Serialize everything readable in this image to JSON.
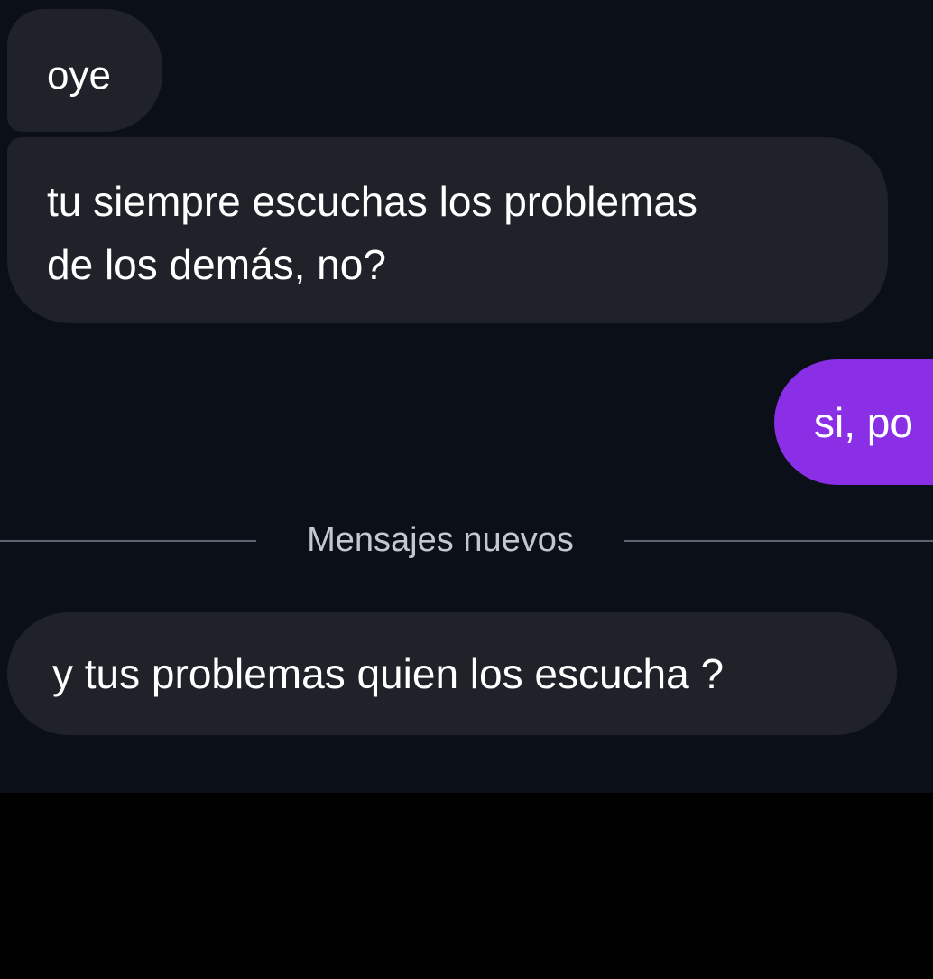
{
  "conversation": {
    "messages": [
      {
        "sender": "other",
        "text": "oye"
      },
      {
        "sender": "other",
        "text": "tu siempre escuchas los problemas\nde los demás, no?"
      },
      {
        "sender": "me",
        "text": "si, po"
      },
      {
        "sender": "other",
        "text": "y tus problemas quien los escucha ?"
      }
    ],
    "new_messages_divider": "Mensajes nuevos"
  },
  "colors": {
    "background": "#0b0f17",
    "incoming_bubble": "#1f2229",
    "outgoing_bubble": "#8a2fe6",
    "text": "#ffffff",
    "divider_text": "#c4c7ce"
  }
}
